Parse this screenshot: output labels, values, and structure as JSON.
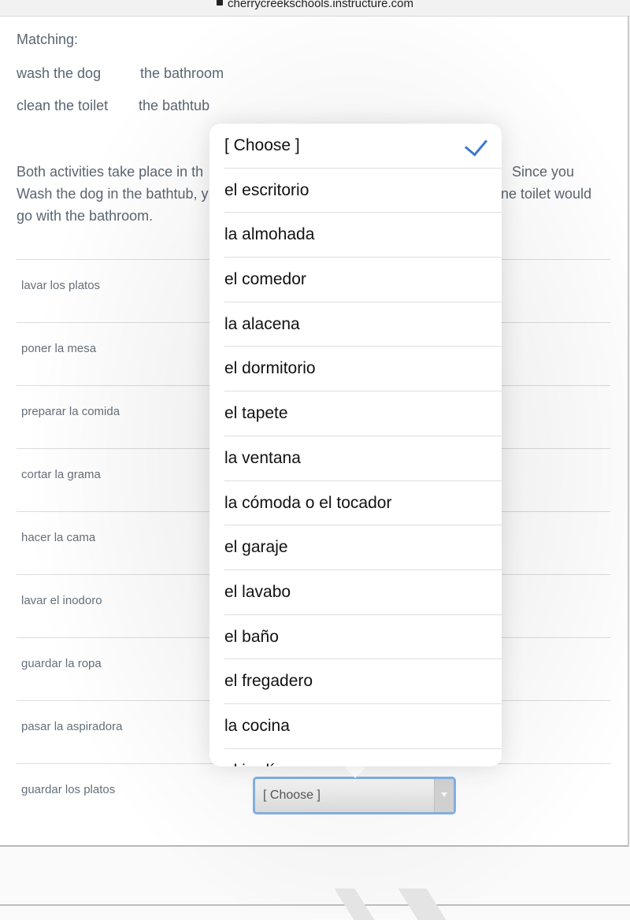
{
  "browser": {
    "url": "cherrycreekschools.instructure.com"
  },
  "question": {
    "heading": "Matching:",
    "example_pairs": [
      {
        "left": "wash the dog",
        "right": "the bathroom"
      },
      {
        "left": "clean the toilet",
        "right": "the bathtub"
      }
    ],
    "explanation_line1_left": "Both activities take place in th",
    "explanation_line1_right": "Since you",
    "explanation_line2_left": "Wash the dog in the bathtub, y",
    "explanation_line2_right": "ne toilet would",
    "explanation_line3": "go with the bathroom."
  },
  "rows": [
    {
      "prompt": "lavar los platos"
    },
    {
      "prompt": "poner la mesa"
    },
    {
      "prompt": "preparar la comida"
    },
    {
      "prompt": "cortar la grama"
    },
    {
      "prompt": "hacer la cama"
    },
    {
      "prompt": "lavar el inodoro"
    },
    {
      "prompt": "guardar la ropa"
    },
    {
      "prompt": "pasar la aspiradora"
    },
    {
      "prompt": "guardar los platos",
      "selected": "[ Choose ]"
    }
  ],
  "dropdown": {
    "selected_index": 0,
    "accent_color": "#3a78d0",
    "options": [
      "[ Choose ]",
      "el escritorio",
      "la almohada",
      "el comedor",
      "la alacena",
      "el dormitorio",
      "el tapete",
      "la ventana",
      "la cómoda o el tocador",
      "el garaje",
      "el lavabo",
      "el baño",
      "el fregadero",
      "la cocina",
      "el jardín"
    ]
  }
}
